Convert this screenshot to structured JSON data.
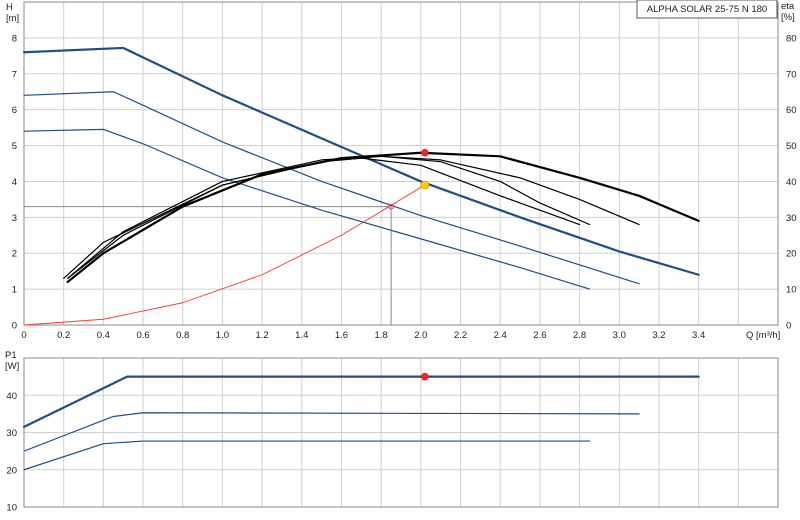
{
  "chart_data": [
    {
      "type": "line",
      "title": "ALPHA SOLAR 25-75 N 180",
      "xlabel": "Q [m³/h]",
      "ylabel_left": "H\n[m]",
      "ylabel_right": "eta\n[%]",
      "xlim": [
        0,
        3.8
      ],
      "ylim": [
        0,
        9
      ],
      "ylim_right": [
        0,
        90
      ],
      "x_ticks": [
        "0",
        "0.2",
        "0.4",
        "0.6",
        "0.8",
        "1.0",
        "1.2",
        "1.4",
        "1.6",
        "1.8",
        "2.0",
        "2.2",
        "2.4",
        "2.6",
        "2.8",
        "3.0",
        "3.2",
        "3.4"
      ],
      "y_ticks": [
        "0",
        "1",
        "2",
        "3",
        "4",
        "5",
        "6",
        "7",
        "8"
      ],
      "y_ticks_right": [
        "0",
        "10",
        "20",
        "30",
        "40",
        "50",
        "60",
        "70",
        "80"
      ],
      "grid": true,
      "colors": {
        "pump": "#1f4e8c",
        "efficiency": "#000000",
        "system": "#ff3333",
        "duty": "#ff2222",
        "operating": "#ffcc00",
        "guide": "#888888"
      },
      "series": [
        {
          "role": "pump",
          "axis": "left",
          "width": 2.2,
          "x": [
            0,
            0.5,
            1.0,
            1.5,
            2.0,
            2.5,
            3.0,
            3.4
          ],
          "values": [
            7.6,
            7.72,
            6.4,
            5.2,
            4.0,
            3.0,
            2.05,
            1.4
          ]
        },
        {
          "role": "pump",
          "axis": "left",
          "width": 1.2,
          "x": [
            0,
            0.45,
            0.55,
            1.0,
            1.5,
            2.0,
            2.5,
            3.1
          ],
          "values": [
            6.4,
            6.5,
            6.25,
            5.1,
            4.0,
            3.05,
            2.2,
            1.15
          ]
        },
        {
          "role": "pump",
          "axis": "left",
          "width": 1.2,
          "x": [
            0,
            0.4,
            0.6,
            1.0,
            1.5,
            2.0,
            2.5,
            2.85
          ],
          "values": [
            5.4,
            5.45,
            5.05,
            4.1,
            3.2,
            2.4,
            1.6,
            1.0
          ]
        },
        {
          "role": "efficiency",
          "axis": "right",
          "width": 2.2,
          "x": [
            0.22,
            0.4,
            0.8,
            1.2,
            1.6,
            2.0,
            2.4,
            2.8,
            3.1,
            3.4
          ],
          "values": [
            12,
            20,
            33,
            42,
            46.5,
            48,
            47,
            41,
            36,
            29
          ]
        },
        {
          "role": "efficiency",
          "axis": "right",
          "width": 1.2,
          "x": [
            0.22,
            0.5,
            1.0,
            1.5,
            1.8,
            2.1,
            2.5,
            2.8,
            3.1
          ],
          "values": [
            13,
            25,
            39,
            45.5,
            47,
            46,
            41,
            35,
            28
          ]
        },
        {
          "role": "efficiency",
          "axis": "right",
          "width": 1.2,
          "x": [
            0.22,
            0.5,
            1.0,
            1.5,
            1.8,
            2.1,
            2.4,
            2.6,
            2.85
          ],
          "values": [
            13,
            26,
            40,
            46,
            47,
            45.5,
            40,
            34,
            28
          ]
        },
        {
          "role": "efficiency",
          "axis": "right",
          "width": 1.2,
          "x": [
            0.2,
            0.4,
            1.0,
            1.5,
            1.7,
            2.0,
            2.4,
            2.8
          ],
          "values": [
            13,
            23,
            39,
            45.5,
            46.5,
            44.5,
            36,
            28
          ]
        },
        {
          "role": "system",
          "axis": "left",
          "width": 0.9,
          "x": [
            0,
            0.4,
            0.8,
            1.2,
            1.6,
            2.02
          ],
          "values": [
            0,
            0.16,
            0.62,
            1.4,
            2.5,
            3.9
          ]
        }
      ],
      "guide_lines": [
        {
          "x": [
            0,
            1.85,
            1.85
          ],
          "values": [
            3.3,
            3.3,
            0
          ]
        }
      ],
      "markers": [
        {
          "role": "duty",
          "axis": "right",
          "x": 2.02,
          "value": 48
        },
        {
          "role": "operating",
          "axis": "left",
          "x": 2.02,
          "value": 3.9
        },
        {
          "role": "system-point",
          "axis": "left",
          "x": 1.85,
          "value": 3.3
        }
      ]
    },
    {
      "type": "line",
      "ylabel": "P1\n[W]",
      "xlim": [
        0,
        3.8
      ],
      "ylim": [
        10,
        50
      ],
      "y_ticks": [
        "10",
        "20",
        "30",
        "40"
      ],
      "grid": true,
      "series": [
        {
          "role": "pump",
          "width": 2.2,
          "x": [
            0,
            0.52,
            3.4
          ],
          "values": [
            31.5,
            45,
            45
          ]
        },
        {
          "role": "pump",
          "width": 1.2,
          "x": [
            0,
            0.45,
            0.6,
            3.1
          ],
          "values": [
            25,
            34.3,
            35.3,
            35
          ]
        },
        {
          "role": "pump",
          "width": 1.2,
          "x": [
            0,
            0.4,
            0.6,
            2.85
          ],
          "values": [
            20,
            27,
            27.7,
            27.7
          ]
        }
      ],
      "markers": [
        {
          "role": "duty",
          "x": 2.02,
          "value": 45
        }
      ]
    }
  ]
}
